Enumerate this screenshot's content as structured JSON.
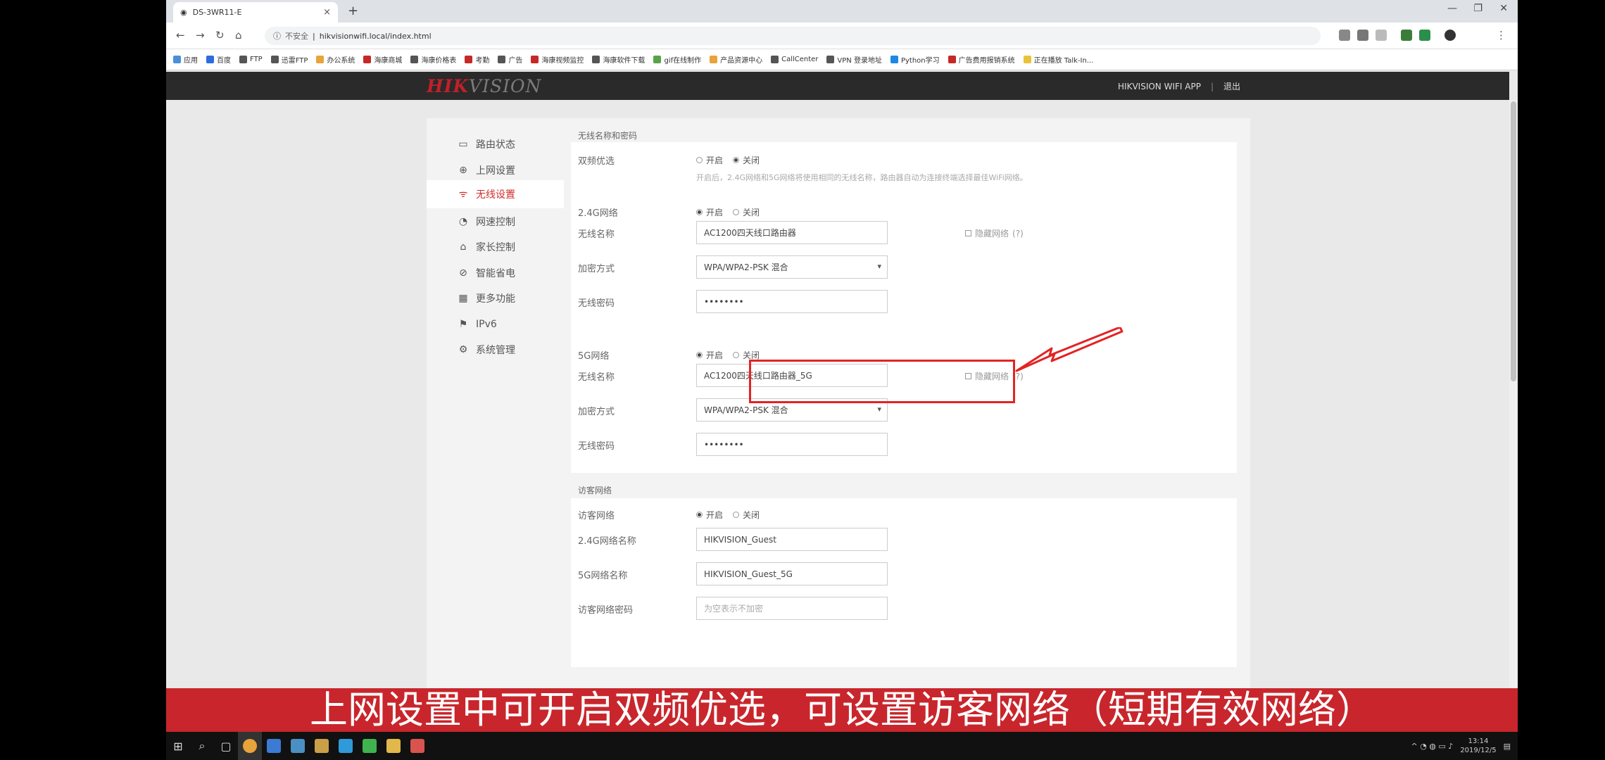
{
  "browser": {
    "tab_title": "DS-3WR11-E",
    "tab_close": "×",
    "new_tab": "+",
    "address_security": "不安全",
    "address_url": "hikvisionwifi.local/index.html",
    "bookmarks": [
      "应用",
      "百度",
      "FTP",
      "迅雷FTP",
      "办公系统",
      "海康商城",
      "海康价格表",
      "考勤",
      "广告",
      "海康视频监控",
      "海康软件下载",
      "gif在线制作",
      "产品资源中心",
      "CallCenter",
      "VPN 登录地址",
      "Python学习",
      "广告费用报销系统",
      "正在播放 Talk-In..."
    ]
  },
  "header": {
    "logo_main": "HIK",
    "logo_rest": "VISION",
    "app_link": "HIKVISION WIFI APP",
    "divider": "|",
    "logout": "退出"
  },
  "sidebar": {
    "items": [
      {
        "label": "路由状态",
        "icon": "▭"
      },
      {
        "label": "上网设置",
        "icon": "⊕"
      },
      {
        "label": "无线设置",
        "icon": "ᯤ"
      },
      {
        "label": "网速控制",
        "icon": "◔"
      },
      {
        "label": "家长控制",
        "icon": "⌂"
      },
      {
        "label": "智能省电",
        "icon": "⊘"
      },
      {
        "label": "更多功能",
        "icon": "▦"
      },
      {
        "label": "IPv6",
        "icon": "⚑"
      },
      {
        "label": "系统管理",
        "icon": "⚙"
      }
    ],
    "active_index": 2
  },
  "wireless": {
    "section_title": "无线名称和密码",
    "dual_band": {
      "label": "双频优选",
      "on": "开启",
      "off": "关闭",
      "hint": "开启后，2.4G网络和5G网络将使用相同的无线名称，路由器自动为连接终端选择最佳WiFi网络。"
    },
    "band24": {
      "label": "2.4G网络",
      "on": "开启",
      "off": "关闭",
      "ssid_label": "无线名称",
      "ssid": "AC1200四天线口路由器",
      "hide_label": "隐藏网络",
      "help": "(?)",
      "enc_label": "加密方式",
      "enc": "WPA/WPA2-PSK 混合",
      "pwd_label": "无线密码",
      "pwd": "••••••••"
    },
    "band5": {
      "label": "5G网络",
      "on": "开启",
      "off": "关闭",
      "ssid_label": "无线名称",
      "ssid": "AC1200四天线口路由器_5G",
      "hide_label": "隐藏网络",
      "help": "(?)",
      "enc_label": "加密方式",
      "enc": "WPA/WPA2-PSK 混合",
      "pwd_label": "无线密码",
      "pwd": "••••••••"
    }
  },
  "guest": {
    "section_title": "访客网络",
    "label": "访客网络",
    "on": "开启",
    "off": "关闭",
    "ssid24_label": "2.4G网络名称",
    "ssid24": "HIKVISION_Guest",
    "ssid5_label": "5G网络名称",
    "ssid5": "HIKVISION_Guest_5G",
    "pwd_label": "访客网络密码",
    "pwd_placeholder": "为空表示不加密"
  },
  "caption": "上网设置中可开启双频优选，可设置访客网络（短期有效网络）",
  "taskbar": {
    "time": "13:14",
    "date": "2019/12/5"
  },
  "colors": {
    "brand_red": "#c0202a",
    "active_red": "#d22b2b",
    "caption_bg": "#c8262c",
    "header_bg": "#2a2a2a"
  }
}
